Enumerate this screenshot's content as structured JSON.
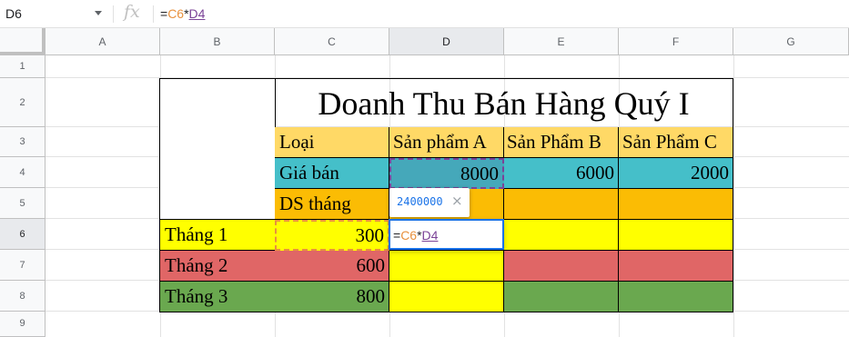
{
  "namebox": {
    "value": "D6"
  },
  "formula_bar": {
    "eq": "=",
    "ref1": "C6",
    "op": "*",
    "ref2": "D4"
  },
  "columns": [
    "A",
    "B",
    "C",
    "D",
    "E",
    "F",
    "G"
  ],
  "rows": [
    "1",
    "2",
    "3",
    "4",
    "5",
    "6",
    "7",
    "8",
    "9"
  ],
  "colors": {
    "header_fill": "#ffd966",
    "price_fill": "#45bfc9",
    "ds_fill": "#fbbc04",
    "yellow": "#ffff00",
    "red": "#e06666",
    "green": "#6aa84f"
  },
  "table": {
    "title": "Doanh Thu Bán Hàng Quý I",
    "header": {
      "loai": "Loại",
      "a": "Sản phẩm A",
      "b": "Sản Phẩm B",
      "c": "Sản Phẩm C"
    },
    "price_row": {
      "label": "Giá bán",
      "a": "8000",
      "b": "6000",
      "c": "2000"
    },
    "ds_label": "DS tháng",
    "months": [
      {
        "label": "Tháng 1",
        "qty": "300"
      },
      {
        "label": "Tháng 2",
        "qty": "600"
      },
      {
        "label": "Tháng 3",
        "qty": "800"
      }
    ]
  },
  "tooltip": {
    "value": "2400000",
    "close": "×"
  },
  "editor": {
    "eq": "=",
    "ref1": "C6",
    "op": "*",
    "ref2": "D4"
  }
}
